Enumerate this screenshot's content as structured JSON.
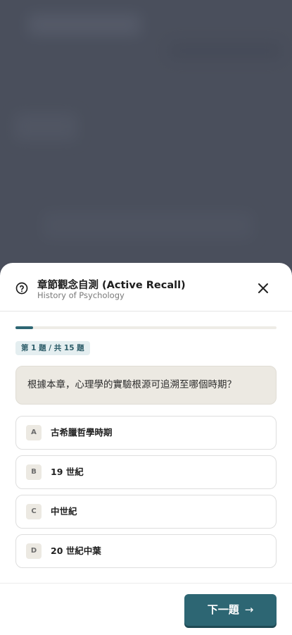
{
  "colors": {
    "backdrop": "#4a4f5c",
    "accent": "#2d6673",
    "question_bg": "#ece9e2",
    "badge_bg": "#e4eef0"
  },
  "dialog": {
    "title": "章節觀念自測 (Active Recall)",
    "subtitle": "History of Psychology",
    "help_icon": "help-circle-icon",
    "close_icon": "close-icon"
  },
  "progress": {
    "current": 1,
    "total": 15,
    "fraction": 0.067,
    "counter_text": "第 1 題 / 共 15 題"
  },
  "question": {
    "text": "根據本章，心理學的實驗根源可追溯至哪個時期？"
  },
  "options": [
    {
      "letter": "A",
      "text": "古希臘哲學時期"
    },
    {
      "letter": "B",
      "text": "19 世紀"
    },
    {
      "letter": "C",
      "text": "中世紀"
    },
    {
      "letter": "D",
      "text": "20 世紀中葉"
    }
  ],
  "footer": {
    "next_label": "下一題",
    "next_icon": "arrow-right-icon"
  }
}
